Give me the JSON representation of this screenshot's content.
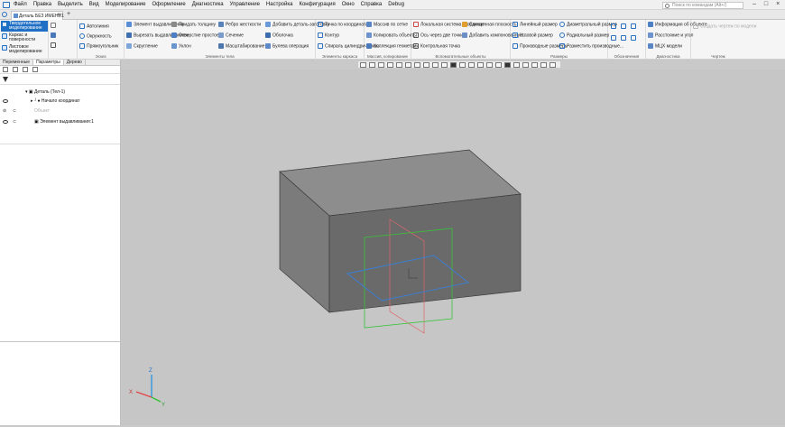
{
  "menu": {
    "items": [
      "Файл",
      "Правка",
      "Выделить",
      "Вид",
      "Моделирование",
      "Оформление",
      "Диагностика",
      "Управление",
      "Настройка",
      "Конфигурация",
      "Окно",
      "Справка",
      "Debug"
    ],
    "search_placeholder": "Поиск по командам (Alt+/)"
  },
  "tabs": {
    "document": "Деталь БЕЗ ИМЕНИ1"
  },
  "ribbon": {
    "modes": [
      "Твердотельное моделирование",
      "Каркас и поверхности",
      "Листовое моделирование"
    ],
    "groups": {
      "sketch": {
        "title": "Эскиз",
        "items": [
          "Автолиния",
          "Окружность",
          "Прямоугольник"
        ]
      },
      "elements": {
        "title": "Элементы тела",
        "items": [
          "Элемент выдавливания",
          "Вырезать выдавливанием",
          "Скругление",
          "Придать толщину",
          "Отверстие простое",
          "Уклон",
          "Ребро жесткости",
          "Сечение",
          "Масштабирование",
          "Добавить деталь-заготовку",
          "Оболочка",
          "Булева операция"
        ]
      },
      "frame": {
        "title": "Элементы каркаса",
        "items": [
          "Точка по координатам",
          "Контур",
          "Спираль цилиндрическая"
        ]
      },
      "copy": {
        "title": "Массив, копирование",
        "items": [
          "Массив по сетке",
          "Копировать объекты",
          "Коллекция геометрии"
        ]
      },
      "aux": {
        "title": "Вспомогательные объекты",
        "items": [
          "Локальная система координат",
          "Ось через две точки",
          "Контрольная точка",
          "Смещенная плоскость",
          "Добавить компоновочную..."
        ]
      },
      "dims": {
        "title": "Размеры",
        "items": [
          "Линейный размер",
          "Угловой размер",
          "Производные размеры",
          "Диаметральный размер",
          "Радиальный размер",
          "Разместить производные..."
        ]
      },
      "notation": {
        "title": "Обозначения"
      },
      "diag": {
        "title": "Диагностика",
        "items": [
          "Информация об объекте",
          "Расстояние и угол",
          "МЦХ модели"
        ]
      },
      "drawing": {
        "title": "Чертеж",
        "items": [
          "Создать чертеж по модели"
        ]
      }
    }
  },
  "left_panel": {
    "tabs": [
      "Переменные",
      "Параметры",
      "Дерево"
    ],
    "tree": [
      {
        "label": "Деталь (Тел-1)",
        "dim": false
      },
      {
        "label": "Начало координат",
        "dim": false
      },
      {
        "label": "Объект",
        "dim": true
      },
      {
        "label": "Элемент выдавливания:1",
        "dim": false
      }
    ]
  },
  "axes": {
    "x": "X",
    "y": "Y",
    "z": "Z"
  },
  "colors": {
    "accent": "#1f6fc5",
    "box_front": "#6a6a6a",
    "box_top": "#8d8d8d",
    "box_side": "#7b7b7b",
    "plane_xy": "#3a7fd5",
    "plane_zx": "#39c43a",
    "plane_zy": "#e0666a"
  }
}
